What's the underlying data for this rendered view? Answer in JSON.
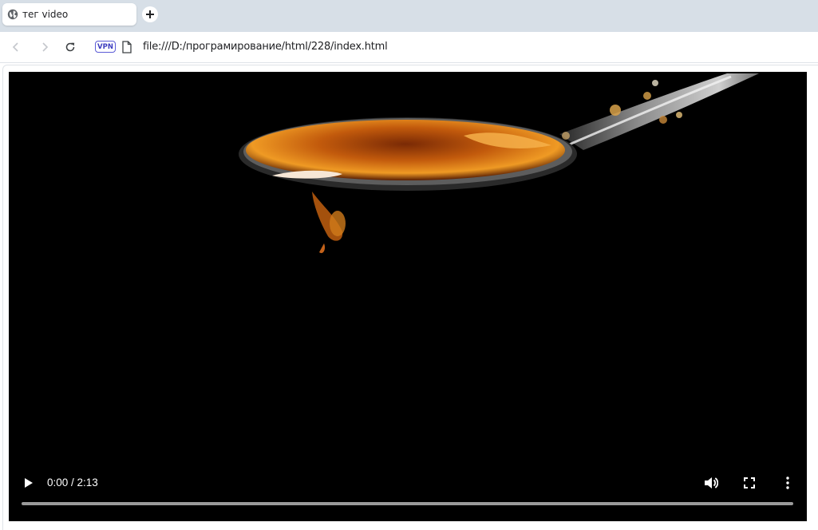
{
  "browser": {
    "tab": {
      "title": "тег video",
      "icon": "globe-icon"
    },
    "new_tab_icon": "plus-icon",
    "toolbar": {
      "back_icon": "back-arrow-icon",
      "forward_icon": "forward-arrow-icon",
      "reload_icon": "reload-icon",
      "vpn_label": "VPN",
      "file_icon": "file-icon",
      "url": "file:///D:/програмирование/html/228/index.html"
    }
  },
  "video": {
    "time_display": "0:00 / 2:13",
    "progress": 0,
    "controls": {
      "play_icon": "play-icon",
      "volume_icon": "volume-icon",
      "fullscreen_icon": "fullscreen-icon",
      "more_icon": "more-vertical-icon"
    }
  }
}
